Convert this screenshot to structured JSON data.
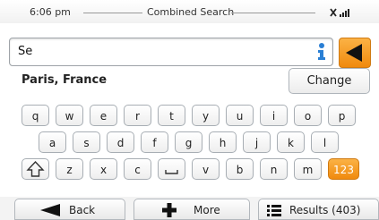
{
  "status_bar": {
    "time": "6:06 pm",
    "title": "Combined Search",
    "signal_icon": "satellite-signal-icon"
  },
  "search": {
    "value": "Se",
    "info_icon": "info-person-icon",
    "back_icon": "backspace-arrow-icon"
  },
  "result": {
    "location": "Paris, France",
    "change_label": "Change"
  },
  "keyboard": {
    "row1": [
      "q",
      "w",
      "e",
      "r",
      "t",
      "y",
      "u",
      "i",
      "o",
      "p"
    ],
    "row2": [
      "a",
      "s",
      "d",
      "f",
      "g",
      "h",
      "j",
      "k",
      "l"
    ],
    "row3": [
      "z",
      "x",
      "c",
      "v",
      "b",
      "n",
      "m"
    ],
    "shift_icon": "shift-arrow-icon",
    "space_icon": "space-bar-icon",
    "numbers_label": "123"
  },
  "bottom_bar": {
    "back_label": "Back",
    "more_label": "More",
    "results_label": "Results (403)"
  },
  "colors": {
    "accent": "#f39a1e",
    "info_blue": "#2a7fd4"
  }
}
